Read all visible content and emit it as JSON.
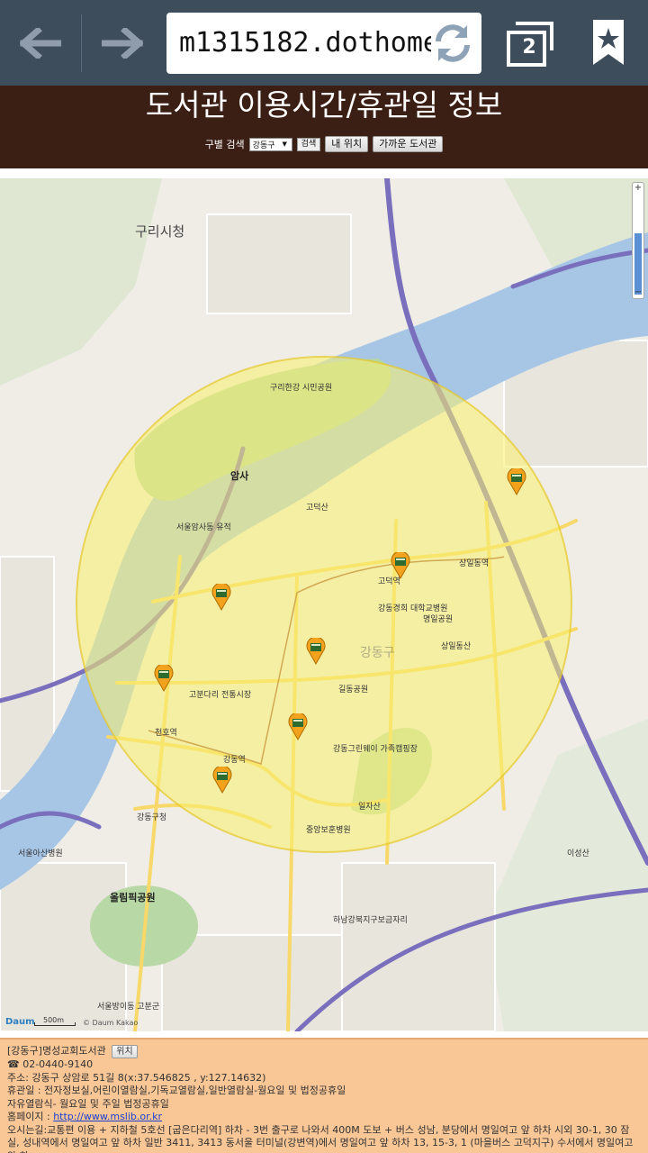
{
  "browser": {
    "url": "m1315182.dothome",
    "tab_count": "2"
  },
  "header": {
    "title": "도서관 이용시간/휴관일 정보",
    "search_label": "구별 검색",
    "district_select": "강동구",
    "search_button": "검색",
    "my_location_button": "내 위치",
    "nearby_button": "가까운 도서관"
  },
  "map": {
    "logo": "Daum",
    "scale": "500m",
    "copyright": "© Daum Kakao",
    "district_big_label": "강동구",
    "labels": {
      "guri_city": "구리시청",
      "amsa": "암사",
      "amsa_ruins": "서울암사동 유적",
      "godeok_san": "고덕산",
      "godeok_station": "고덕역",
      "sangil_station": "상일동역",
      "kyunghee": "강동경희 대학교병원",
      "myeongil_park": "명일공원",
      "sangil_park": "상일동산",
      "gildong_park": "길동공원",
      "gangdong_greenway": "강동그린웨이 가족캠핑장",
      "iljasan": "일자산",
      "cheonho": "천호역",
      "gangdong_station": "강동역",
      "gangdong_office": "강동구청",
      "olympic_park": "올림픽공원",
      "seoul_asan": "서울아산병원",
      "guri_hangang": "구리한강 시민공원",
      "isungsan": "이성산",
      "hanam_junction": "하남강북지구보금자리",
      "seoul_bang": "서울방이동 고분군",
      "gubundari": "고분다리 전통시장",
      "jungang_hospital": "중앙보훈병원"
    }
  },
  "library": {
    "name": "[강동구]명성교회도서관",
    "locate_button": "위치",
    "phone": "☎ 02-0440-9140",
    "address": "주소: 강동구 상암로 51길 8(x:37.546825 , y:127.14632)",
    "closed": "휴관일 : 전자정보실,어린이열람실,기독교열람실,일반열람실-월요일 및 법정공휴일",
    "free_reading": "자유열람식- 월요일 및 주일 법정공휴일",
    "homepage_label": "홈페이지 :",
    "homepage_url": "http://www.mslib.or.kr",
    "directions": "오시는길:교통편 이용 + 지하철 5호선 [굽은다리역] 하차 - 3번 출구로 나와서 400M 도보 + 버스 성남, 분당에서 명일여고 앞 하차 시외 30-1, 30 잠실, 성내역에서 명일여고 앞 하차 일반 3411, 3413 동서울 터미널(강변역)에서 명일여고 앞 하차 13, 15-3, 1 (마을버스 고덕지구) 수서에서 명일여고 앞 하"
  }
}
